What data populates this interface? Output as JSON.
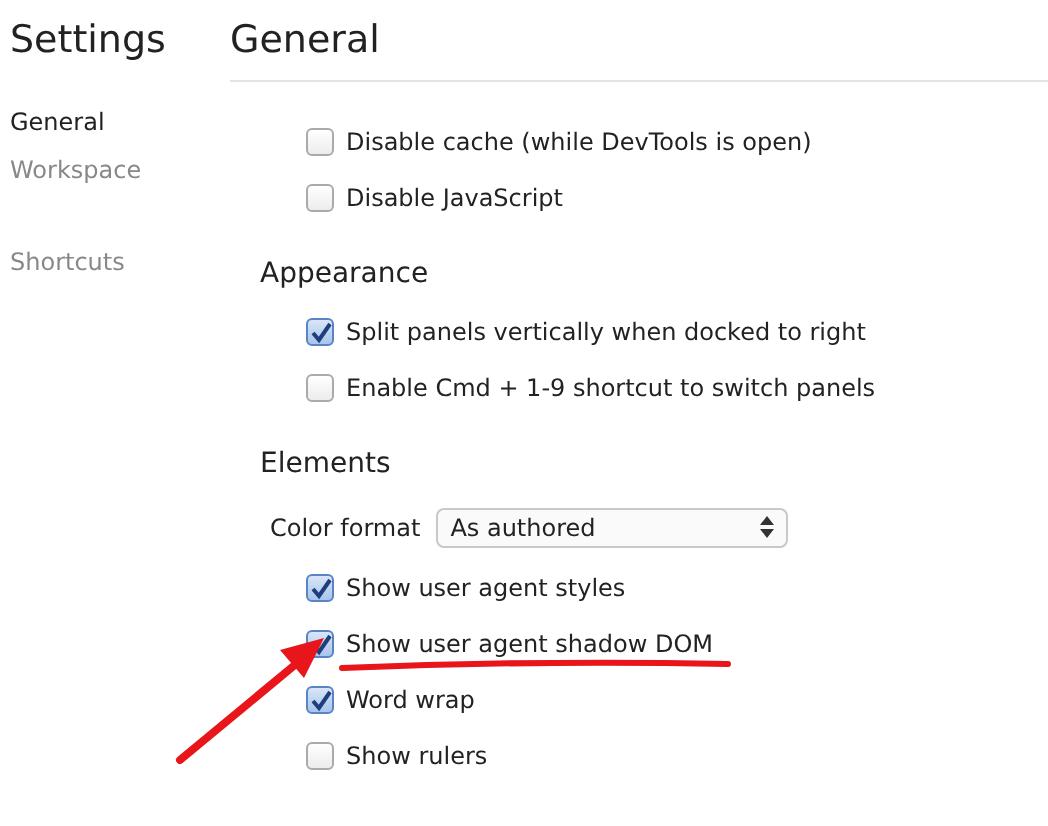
{
  "sidebar": {
    "title": "Settings",
    "items": [
      {
        "label": "General",
        "selected": true
      },
      {
        "label": "Workspace",
        "selected": false
      },
      {
        "label": "Shortcuts",
        "selected": false
      }
    ]
  },
  "page": {
    "title": "General",
    "sections": [
      {
        "items": [
          {
            "kind": "checkbox",
            "label": "Disable cache (while DevTools is open)",
            "checked": false
          },
          {
            "kind": "checkbox",
            "label": "Disable JavaScript",
            "checked": false
          }
        ]
      },
      {
        "heading": "Appearance",
        "items": [
          {
            "kind": "checkbox",
            "label": "Split panels vertically when docked to right",
            "checked": true
          },
          {
            "kind": "checkbox",
            "label": "Enable Cmd + 1-9 shortcut to switch panels",
            "checked": false
          }
        ]
      },
      {
        "heading": "Elements",
        "items": [
          {
            "kind": "select",
            "label": "Color format",
            "value": "As authored"
          },
          {
            "kind": "checkbox",
            "label": "Show user agent styles",
            "checked": true
          },
          {
            "kind": "checkbox",
            "label": "Show user agent shadow DOM",
            "checked": true,
            "highlighted": true
          },
          {
            "kind": "checkbox",
            "label": "Word wrap",
            "checked": true
          },
          {
            "kind": "checkbox",
            "label": "Show rulers",
            "checked": false
          }
        ]
      }
    ]
  }
}
